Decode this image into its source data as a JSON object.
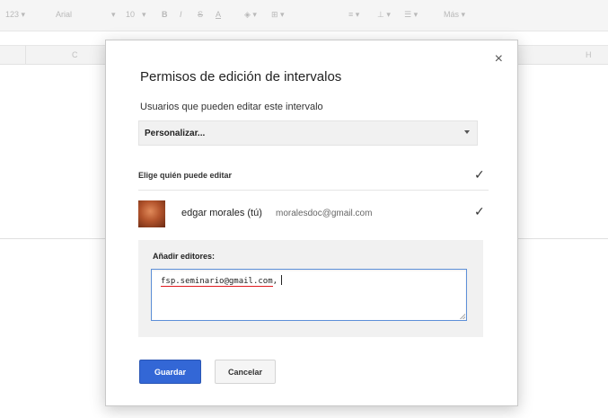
{
  "toolbar": {
    "number_format": "123 ▾",
    "font": "Arial",
    "font_caret": "▾",
    "font_size": "10",
    "size_caret": "▾",
    "bold": "B",
    "italic": "I",
    "strike": "S",
    "text_color": "A",
    "fill": "◈ ▾",
    "borders": "⊞ ▾",
    "align": "≡ ▾",
    "valign": "⊥ ▾",
    "wrap": "☰ ▾",
    "more": "Más ▾"
  },
  "column_header": {
    "col_c": "C",
    "col_h": "H"
  },
  "dialog": {
    "title": "Permisos de edición de intervalos",
    "subtitle": "Usuarios que pueden editar este intervalo",
    "close_symbol": "×",
    "select_value": "Personalizar...",
    "choose_label": "Elige quién puede editar",
    "check_symbol": "✓",
    "user": {
      "name": "edgar morales (tú)",
      "email": "moralesdoc@gmail.com"
    },
    "editors": {
      "label": "Añadir editores:",
      "typed_address": "fsp.seminario@gmail.com",
      "typed_suffix": ","
    },
    "save_label": "Guardar",
    "cancel_label": "Cancelar"
  },
  "colors": {
    "primary_button": "#3367d6",
    "textarea_focus": "#5d8fd8",
    "spellcheck_underline": "#e0191f"
  }
}
